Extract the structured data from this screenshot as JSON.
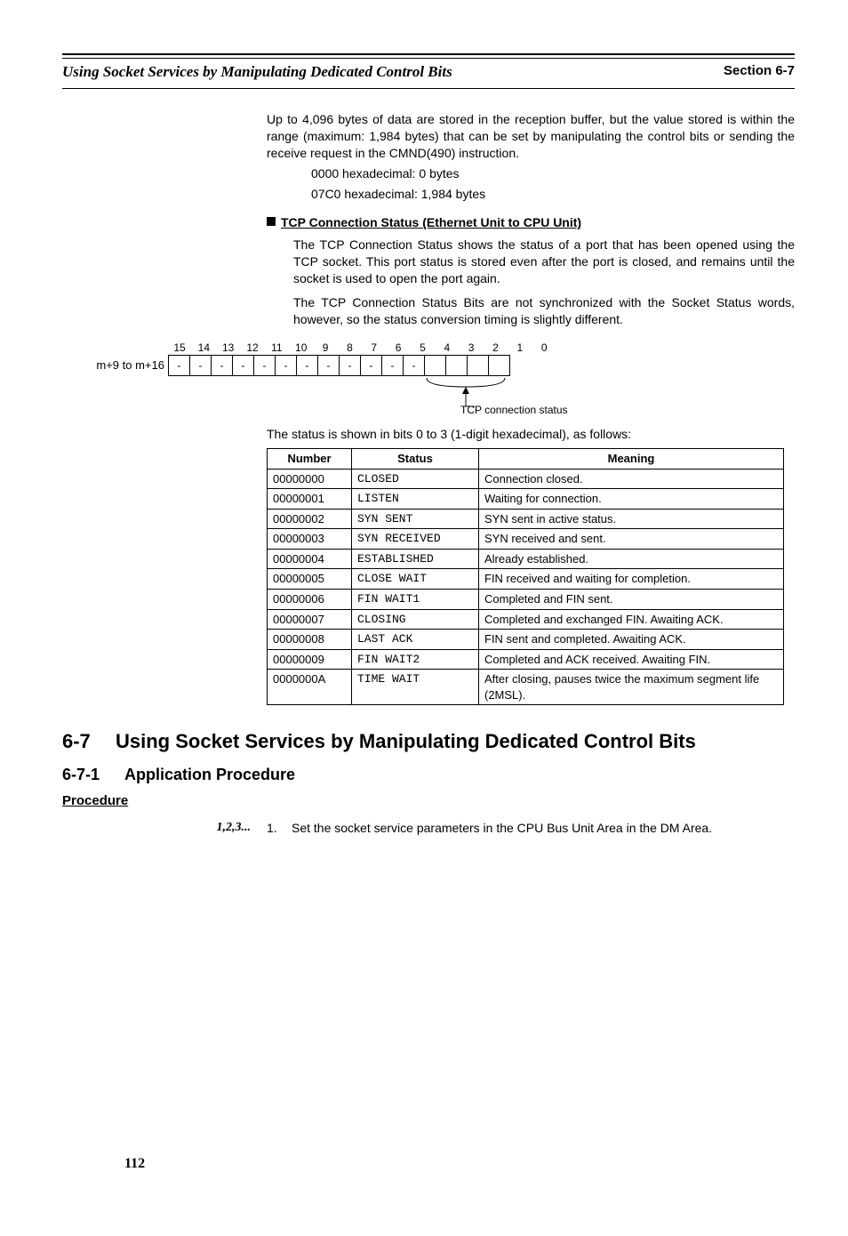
{
  "header": {
    "left": "Using Socket Services by Manipulating Dedicated Control Bits",
    "right": "Section 6-7"
  },
  "intro": {
    "p1": "Up to 4,096 bytes of data are stored in the reception buffer, but the value stored is within the range (maximum: 1,984 bytes) that can be set by manipulating the control bits or sending the receive request in the CMND(490) instruction.",
    "line1": "0000 hexadecimal: 0 bytes",
    "line2": "07C0 hexadecimal: 1,984 bytes"
  },
  "tcp_head": "TCP Connection Status (Ethernet Unit to CPU Unit)",
  "tcp_body": {
    "p1": "The TCP Connection Status shows the status of a port that has been opened using the TCP socket. This port status is stored even after the port is closed, and remains until the socket is used to open the port again.",
    "p2": "The TCP Connection Status Bits are not synchronized with the Socket Status words, however, so the status conversion timing is slightly different."
  },
  "diagram": {
    "row_label": "m+9 to m+16",
    "bit_nums": [
      "15",
      "14",
      "13",
      "12",
      "11",
      "10",
      "9",
      "8",
      "7",
      "6",
      "5",
      "4",
      "3",
      "2",
      "1",
      "0"
    ],
    "dashes": [
      "-",
      "-",
      "-",
      "-",
      "-",
      "-",
      "-",
      "-",
      "-",
      "-",
      "-",
      "-",
      "",
      "",
      "",
      ""
    ],
    "pointer_label": "TCP connection status"
  },
  "table_intro": "The status is shown in bits 0 to 3 (1-digit hexadecimal), as follows:",
  "table": {
    "headers": [
      "Number",
      "Status",
      "Meaning"
    ],
    "rows": [
      {
        "num": "00000000",
        "status": "CLOSED",
        "mean": "Connection closed."
      },
      {
        "num": "00000001",
        "status": "LISTEN",
        "mean": "Waiting for connection."
      },
      {
        "num": "00000002",
        "status": "SYN SENT",
        "mean": "SYN sent in active status."
      },
      {
        "num": "00000003",
        "status": "SYN RECEIVED",
        "mean": "SYN received and sent."
      },
      {
        "num": "00000004",
        "status": "ESTABLISHED",
        "mean": "Already established."
      },
      {
        "num": "00000005",
        "status": "CLOSE WAIT",
        "mean": "FIN received and waiting for completion."
      },
      {
        "num": "00000006",
        "status": "FIN WAIT1",
        "mean": "Completed and FIN sent."
      },
      {
        "num": "00000007",
        "status": "CLOSING",
        "mean": "Completed and exchanged FIN. Awaiting ACK."
      },
      {
        "num": "00000008",
        "status": "LAST ACK",
        "mean": "FIN sent and completed. Awaiting ACK."
      },
      {
        "num": "00000009",
        "status": "FIN WAIT2",
        "mean": "Completed and ACK received. Awaiting FIN."
      },
      {
        "num": "0000000A",
        "status": "TIME WAIT",
        "mean": "After closing, pauses twice the maximum segment life (2MSL)."
      }
    ]
  },
  "section": {
    "num": "6-7",
    "title": "Using Socket Services by Manipulating Dedicated Control Bits",
    "sub_num": "6-7-1",
    "sub_title": "Application Procedure",
    "proc": "Procedure",
    "step_lead": "1,2,3...",
    "step_num": "1.",
    "step_text": "Set the socket service parameters in the CPU Bus Unit Area in the DM Area."
  },
  "page_number": "112"
}
